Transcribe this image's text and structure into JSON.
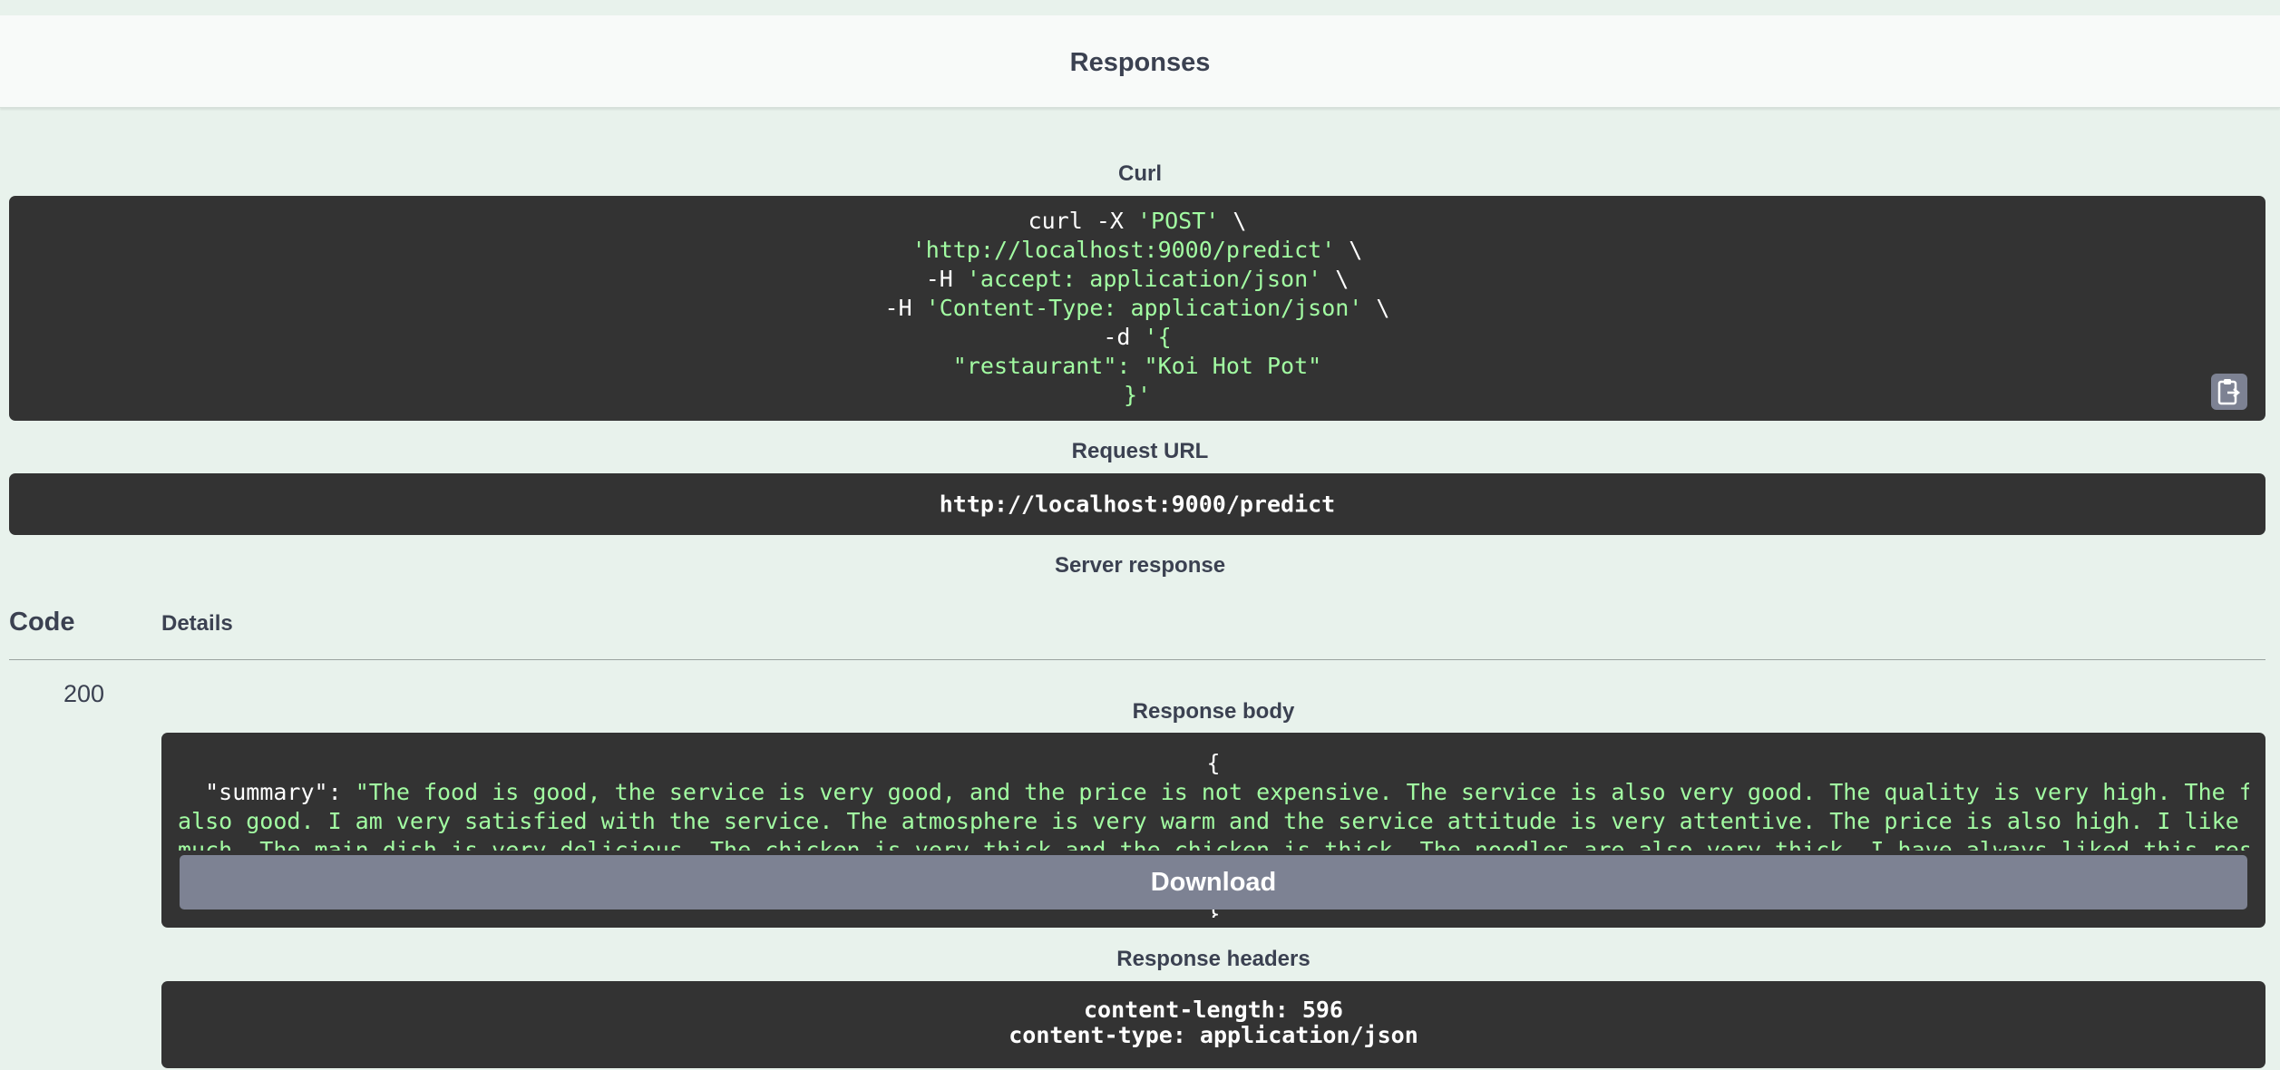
{
  "responses": {
    "title": "Responses"
  },
  "curl": {
    "label": "Curl",
    "line1_plain": "curl -X ",
    "line1_str": "'POST'",
    "line1_tail": " \\",
    "line2_str": "'http://localhost:9000/predict'",
    "line2_tail": " \\",
    "line3_plain": "-H ",
    "line3_str": "'accept: application/json'",
    "line3_tail": " \\",
    "line4_plain": "-H ",
    "line4_str": "'Content-Type: application/json'",
    "line4_tail": " \\",
    "line5_plain": "-d ",
    "line5_str": "'{",
    "line6_str": "\"restaurant\": \"Koi Hot Pot\"",
    "line7_str": "}'",
    "copy_icon": "clipboard-copy-icon"
  },
  "request_url": {
    "label": "Request URL",
    "value": "http://localhost:9000/predict"
  },
  "server_response": {
    "label": "Server response",
    "code_header": "Code",
    "details_header": "Details",
    "status_code": "200",
    "body_label": "Response body",
    "body_open": "{",
    "body_key": "\"summary\"",
    "body_colon": ": ",
    "body_line1": "\"The food is good, the service is very good, and the price is not expensive. The service is also very good. The quality is very high. The food is",
    "body_line2": "also good. I am very satisfied with the service. The atmosphere is very warm and the service attitude is very attentive. The price is also high. I like it very",
    "body_line3": "much. The main dish is very delicious. The chicken is very thick and the chicken is thick. The noodles are also very thick. I have always liked this restauran",
    "body_close": "}",
    "download_label": "Download",
    "headers_label": "Response headers",
    "header_line1": "content-length: 596",
    "header_line2": "content-type: application/json"
  }
}
